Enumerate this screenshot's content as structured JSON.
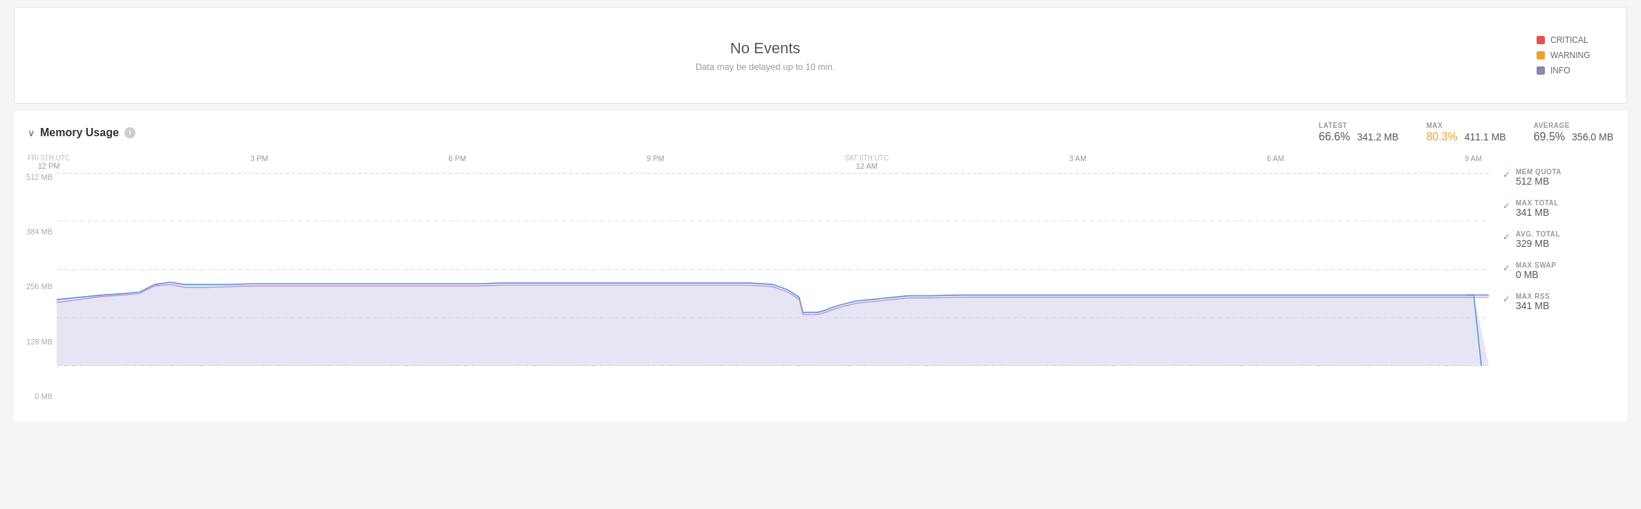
{
  "events": {
    "title": "No Events",
    "subtitle": "Data may be delayed up to 10 min.",
    "legend": [
      {
        "key": "critical",
        "label": "CRITICAL",
        "color": "#e05252"
      },
      {
        "key": "warning",
        "label": "WARNING",
        "color": "#f0a030"
      },
      {
        "key": "info",
        "label": "INFO",
        "color": "#8888aa"
      }
    ]
  },
  "memory": {
    "section_title": "Memory Usage",
    "info_icon": "i",
    "chevron": "∨",
    "latest_label": "LATEST",
    "latest_pct": "66.6%",
    "latest_mb": "341.2 MB",
    "max_label": "MAX",
    "max_pct": "80.3%",
    "max_mb": "411.1 MB",
    "avg_label": "AVERAGE",
    "avg_pct": "69.5%",
    "avg_mb": "356.0 MB",
    "x_axis": [
      {
        "date": "FRI 5TH UTC",
        "time": "12 PM"
      },
      {
        "date": "",
        "time": "3 PM"
      },
      {
        "date": "",
        "time": "6 PM"
      },
      {
        "date": "",
        "time": "9 PM"
      },
      {
        "date": "SAT 6TH UTC",
        "time": "12 AM"
      },
      {
        "date": "",
        "time": "3 AM"
      },
      {
        "date": "",
        "time": "6 AM"
      },
      {
        "date": "",
        "time": "9 AM"
      }
    ],
    "y_axis": [
      "512 MB",
      "384 MB",
      "256 MB",
      "128 MB",
      "0 MB"
    ],
    "sidebar_metrics": [
      {
        "label": "MEM QUOTA",
        "value": "512 MB"
      },
      {
        "label": "MAX TOTAL",
        "value": "341 MB"
      },
      {
        "label": "AVG. TOTAL",
        "value": "329 MB"
      },
      {
        "label": "MAX SWAP",
        "value": "0 MB"
      },
      {
        "label": "MAX RSS",
        "value": "341 MB"
      }
    ]
  }
}
